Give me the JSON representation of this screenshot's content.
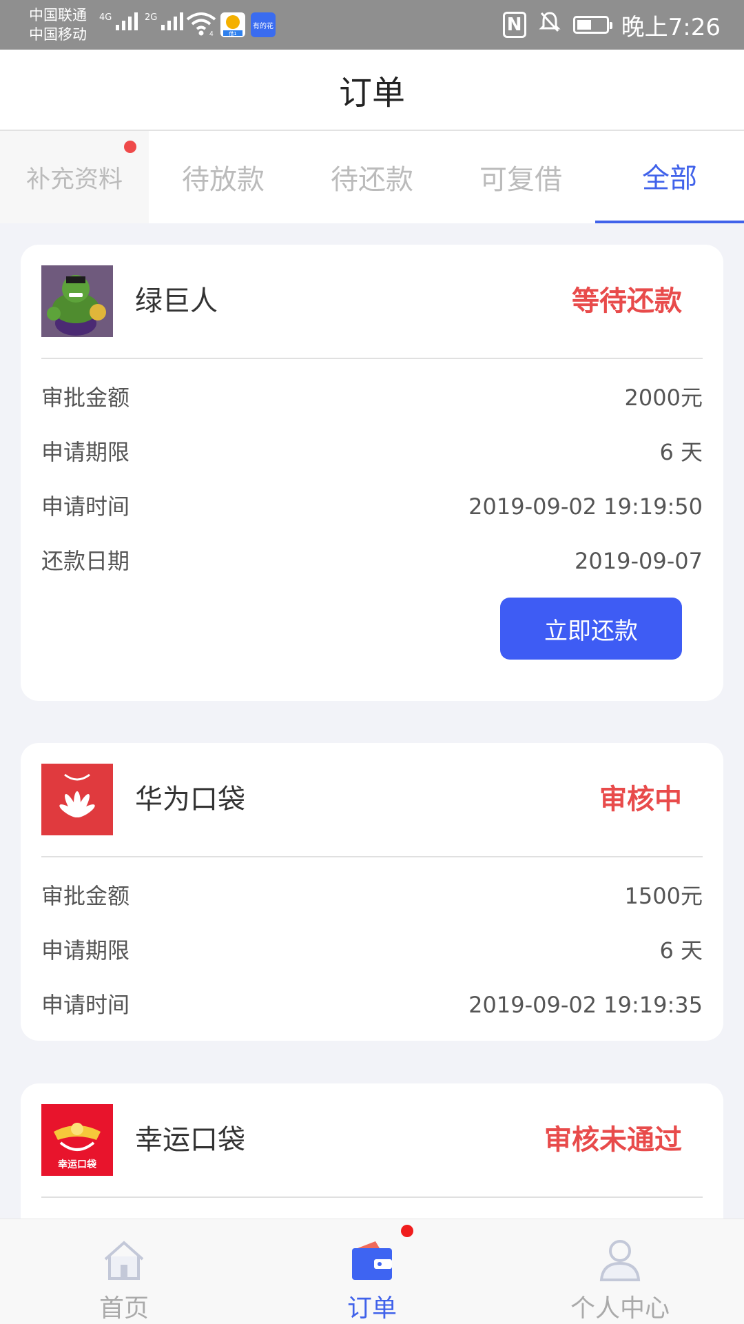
{
  "status_bar": {
    "carrier_1": "中国联通",
    "carrier_2": "中国移动",
    "sim1_network": "4G",
    "sim2_network": "2G",
    "wifi_badge": "4",
    "app_icon_1_label": "借1",
    "app_icon_2_label": "有的花",
    "time": "晚上7:26",
    "icons": [
      "signal-icon",
      "wifi-icon",
      "nfc-icon",
      "mute-icon",
      "battery-icon"
    ]
  },
  "header": {
    "title": "订单"
  },
  "tabs": [
    {
      "label": "补充资料",
      "badge": true
    },
    {
      "label": "待放款"
    },
    {
      "label": "待还款"
    },
    {
      "label": "可复借"
    },
    {
      "label": "全部",
      "active": true
    }
  ],
  "orders": [
    {
      "name": "绿巨人",
      "status": "等待还款",
      "logo_icon": "hulk-logo",
      "rows": [
        {
          "label": "审批金额",
          "value": "2000元"
        },
        {
          "label": "申请期限",
          "value": "6 天"
        },
        {
          "label": "申请时间",
          "value": "2019-09-02 19:19:50"
        },
        {
          "label": "还款日期",
          "value": "2019-09-07"
        }
      ],
      "button": "立即还款"
    },
    {
      "name": "华为口袋",
      "status": "审核中",
      "logo_icon": "huawei-pocket-logo",
      "rows": [
        {
          "label": "审批金额",
          "value": "1500元"
        },
        {
          "label": "申请期限",
          "value": "6 天"
        },
        {
          "label": "申请时间",
          "value": "2019-09-02 19:19:35"
        }
      ]
    },
    {
      "name": "幸运口袋",
      "status": "审核未通过",
      "logo_icon": "lucky-pocket-logo",
      "logo_text": "幸运口袋"
    }
  ],
  "bottom_nav": [
    {
      "label": "首页",
      "icon": "home-icon"
    },
    {
      "label": "订单",
      "icon": "wallet-icon",
      "active": true,
      "badge": true
    },
    {
      "label": "个人中心",
      "icon": "user-icon"
    }
  ],
  "colors": {
    "accent": "#4062ea",
    "button": "#3e5cf4",
    "status_red": "#e84b4b",
    "background": "#f2f3f8"
  }
}
